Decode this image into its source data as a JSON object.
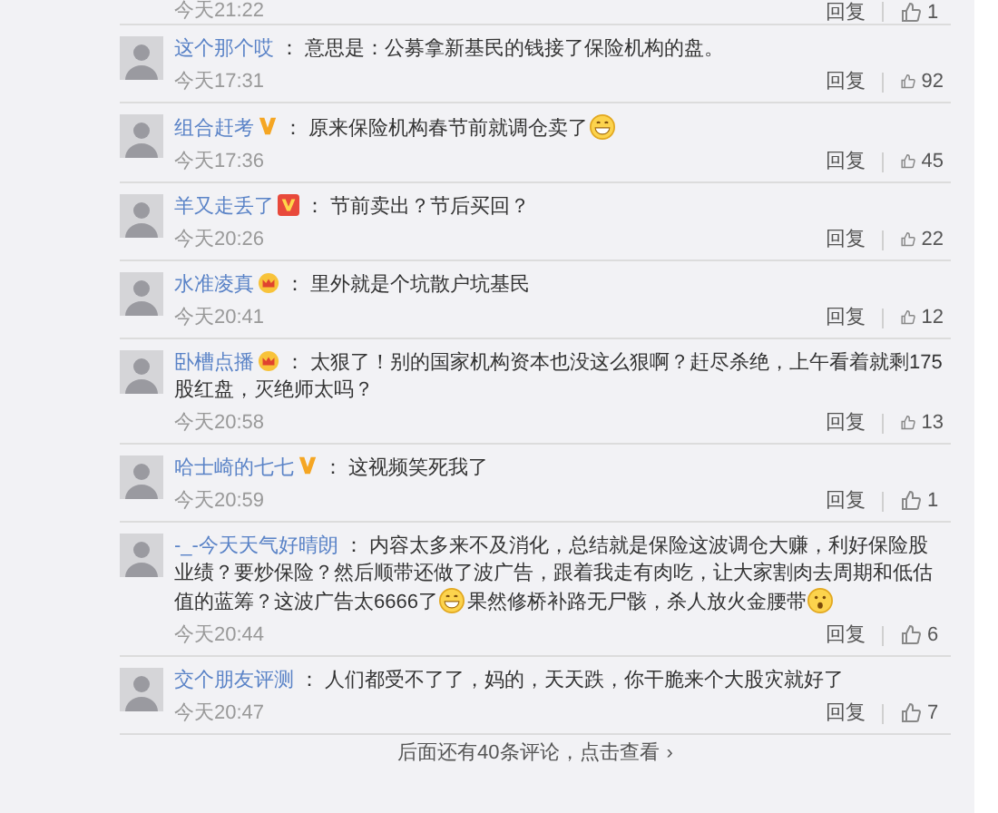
{
  "top_partial": {
    "time": "今天21:22",
    "reply": "回复",
    "likes": "1"
  },
  "comments": [
    {
      "user": "这个那个哎",
      "sep": "：",
      "parts": [
        {
          "kind": "text",
          "text": "意思是：公募拿新基民的钱接了保险机构的盘。"
        }
      ],
      "time": "今天17:31",
      "reply": "回复",
      "likes": "92"
    },
    {
      "user": "组合赶考",
      "badge": {
        "kind": "v"
      },
      "sep": "：",
      "parts": [
        {
          "kind": "text",
          "text": "原来保险机构春节前就调仓卖了"
        },
        {
          "kind": "grin"
        }
      ],
      "time": "今天17:36",
      "reply": "回复",
      "likes": "45"
    },
    {
      "user": "羊又走丢了",
      "badge": {
        "kind": "vbox"
      },
      "sep": "：",
      "parts": [
        {
          "kind": "text",
          "text": "节前卖出？节后买回？"
        }
      ],
      "time": "今天20:26",
      "reply": "回复",
      "likes": "22"
    },
    {
      "user": "水准凌真",
      "badge": {
        "kind": "crown"
      },
      "sep": "：",
      "parts": [
        {
          "kind": "text",
          "text": "里外就是个坑散户坑基民"
        }
      ],
      "time": "今天20:41",
      "reply": "回复",
      "likes": "12"
    },
    {
      "user": "卧槽点播",
      "badge": {
        "kind": "crown"
      },
      "sep": "：",
      "parts": [
        {
          "kind": "text",
          "text": "太狠了！别的国家机构资本也没这么狠啊？赶尽杀绝，上午看着就剩175股红盘，灭绝师太吗？"
        }
      ],
      "time": "今天20:58",
      "reply": "回复",
      "likes": "13"
    },
    {
      "user": "哈士崎的七七",
      "badge": {
        "kind": "v"
      },
      "sep": "：",
      "parts": [
        {
          "kind": "text",
          "text": "这视频笑死我了"
        }
      ],
      "time": "今天20:59",
      "reply": "回复",
      "likes": "1"
    },
    {
      "user": "-_-今天天气好晴朗",
      "sep": "：",
      "parts": [
        {
          "kind": "text",
          "text": "内容太多来不及消化，总结就是保险这波调仓大赚，利好保险股业绩？要炒保险？然后顺带还做了波广告，跟着我走有肉吃，让大家割肉去周期和低估值的蓝筹？这波广告太6666了"
        },
        {
          "kind": "grin"
        },
        {
          "kind": "text",
          "text": "果然修桥补路无尸骸，杀人放火金腰带"
        },
        {
          "kind": "shock"
        }
      ],
      "time": "今天20:44",
      "reply": "回复",
      "likes": "6"
    },
    {
      "user": "交个朋友评测",
      "sep": "：",
      "parts": [
        {
          "kind": "text",
          "text": "人们都受不了了，妈的，天天跌，你干脆来个大股灾就好了"
        }
      ],
      "time": "今天20:47",
      "reply": "回复",
      "likes": "7"
    }
  ],
  "more": {
    "text": "后面还有40条评论，点击查看",
    "arrow": "›"
  }
}
